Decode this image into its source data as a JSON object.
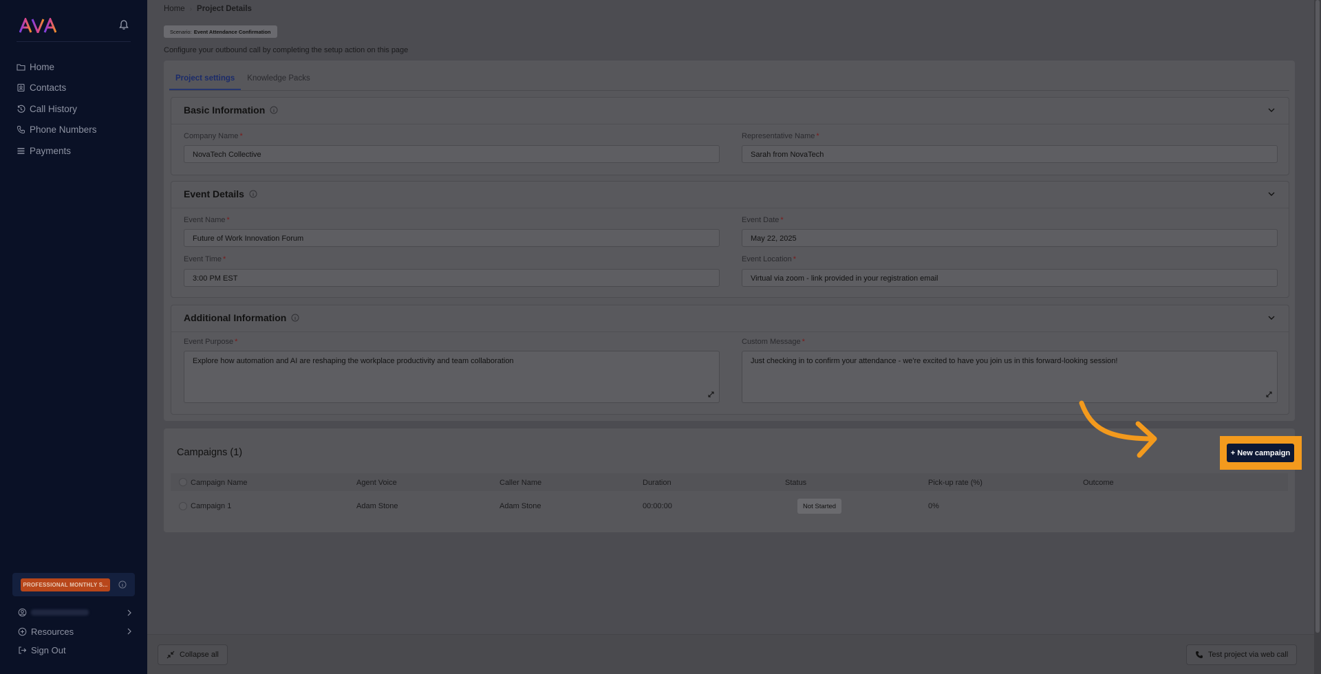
{
  "sidebar": {
    "logo_text": "AVA",
    "items": [
      {
        "label": "Home",
        "icon": "folder-icon"
      },
      {
        "label": "Contacts",
        "icon": "contacts-icon"
      },
      {
        "label": "Call History",
        "icon": "history-icon"
      },
      {
        "label": "Phone Numbers",
        "icon": "phone-icon"
      },
      {
        "label": "Payments",
        "icon": "wallet-icon"
      }
    ],
    "plan_badge": "PROFESSIONAL MONTHLY S...",
    "bottom_items": [
      {
        "label": "",
        "icon": "user-circle-icon"
      },
      {
        "label": "Resources",
        "icon": "resources-icon"
      },
      {
        "label": "Sign Out",
        "icon": "sign-out-icon"
      }
    ]
  },
  "breadcrumb": {
    "home": "Home",
    "current": "Project Details"
  },
  "scenario": {
    "label": "Scenario:",
    "value": "Event Attendance Confirmation"
  },
  "subtitle": "Configure your outbound call by completing the setup action on this page",
  "tabs": [
    {
      "label": "Project settings",
      "active": true
    },
    {
      "label": "Knowledge Packs",
      "active": false
    }
  ],
  "basic_info": {
    "title": "Basic Information",
    "company_label": "Company Name",
    "company_value": "NovaTech Collective",
    "rep_label": "Representative Name",
    "rep_value": "Sarah from NovaTech"
  },
  "event_details": {
    "title": "Event Details",
    "name_label": "Event Name",
    "name_value": "Future of Work Innovation Forum",
    "date_label": "Event Date",
    "date_value": "May 22, 2025",
    "time_label": "Event Time",
    "time_value": "3:00 PM EST",
    "location_label": "Event Location",
    "location_value": "Virtual via zoom - link provided in your registration email"
  },
  "additional_info": {
    "title": "Additional Information",
    "purpose_label": "Event Purpose",
    "purpose_value": "Explore how automation and AI are reshaping the workplace productivity and team collaboration",
    "message_label": "Custom Message",
    "message_value": "Just checking in to confirm your attendance - we're excited to have you join us in this forward-looking session!"
  },
  "required_mark": "*",
  "campaigns": {
    "title": "Campaigns (1)",
    "new_button": "+ New campaign",
    "columns": [
      "Campaign Name",
      "Agent Voice",
      "Caller Name",
      "Duration",
      "Status",
      "Pick-up rate (%)",
      "Outcome"
    ],
    "rows": [
      {
        "name": "Campaign 1",
        "voice": "Adam Stone",
        "caller": "Adam Stone",
        "duration": "00:00:00",
        "status": "Not Started",
        "pickup": "0%",
        "outcome": ""
      }
    ]
  },
  "footer": {
    "collapse": "Collapse all",
    "test": "Test project via web call"
  },
  "colors": {
    "highlight": "#f39a1d",
    "primary_button": "#0d1834",
    "sidebar_bg": "#0a1126",
    "plan_badge": "#b8461a"
  }
}
